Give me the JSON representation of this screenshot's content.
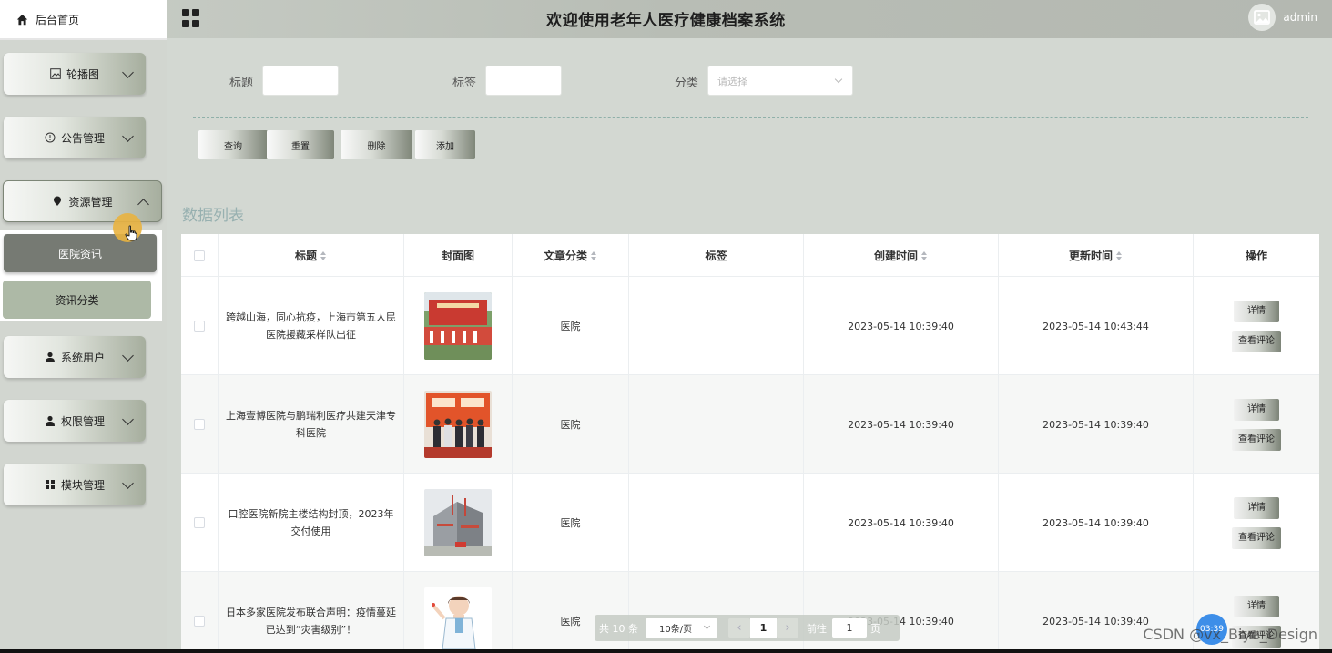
{
  "header": {
    "home_tab": "后台首页",
    "title": "欢迎使用老年人医疗健康档案系统",
    "username": "admin"
  },
  "sidebar": {
    "items": [
      {
        "label": "轮播图",
        "icon": "image-icon"
      },
      {
        "label": "公告管理",
        "icon": "info-circle-icon"
      },
      {
        "label": "资源管理",
        "icon": "pin-icon",
        "expanded": true
      },
      {
        "label": "系统用户",
        "icon": "user-icon"
      },
      {
        "label": "权限管理",
        "icon": "user-icon"
      },
      {
        "label": "模块管理",
        "icon": "grid-icon"
      }
    ],
    "submenu": [
      "医院资讯",
      "资讯分类"
    ],
    "active_submenu": "医院资讯"
  },
  "search": {
    "title_label": "标题",
    "tag_label": "标签",
    "category_label": "分类",
    "category_placeholder": "请选择"
  },
  "actions": {
    "query": "查询",
    "reset": "重置",
    "delete": "删除",
    "add": "添加"
  },
  "list_title": "数据列表",
  "table": {
    "columns": [
      "标题",
      "封面图",
      "文章分类",
      "标签",
      "创建时间",
      "更新时间",
      "操作"
    ],
    "rows": [
      {
        "title": "跨越山海，同心抗疫，上海市第五人民医院援藏采样队出征",
        "category": "医院",
        "tag": "",
        "created": "2023-05-14 10:39:40",
        "updated": "2023-05-14 10:43:44"
      },
      {
        "title": "上海壹博医院与鹏瑞利医疗共建天津专科医院",
        "category": "医院",
        "tag": "",
        "created": "2023-05-14 10:39:40",
        "updated": "2023-05-14 10:39:40"
      },
      {
        "title": "口腔医院新院主楼结构封顶，2023年交付使用",
        "category": "医院",
        "tag": "",
        "created": "2023-05-14 10:39:40",
        "updated": "2023-05-14 10:39:40"
      },
      {
        "title": "日本多家医院发布联合声明：疫情蔓延已达到“灾害级别”！",
        "category": "医院",
        "tag": "",
        "created": "2023-05-14 10:39:40",
        "updated": "2023-05-14 10:39:40"
      }
    ],
    "op_detail": "详情",
    "op_comments": "查看评论"
  },
  "pagination": {
    "total": "共 10 条",
    "page_size": "10条/页",
    "prev": "‹",
    "current": "1",
    "next": "›",
    "goto_label": "前往",
    "goto_value": "1",
    "page_unit": "页"
  },
  "float_badge": "03:39",
  "watermark": "CSDN @vx_Biye_Design",
  "colors": {
    "topbar": "#b8bdb5",
    "sidebar": "#d2d6d0",
    "active_menu": "#767a73",
    "list_title": "#97b0b0"
  }
}
